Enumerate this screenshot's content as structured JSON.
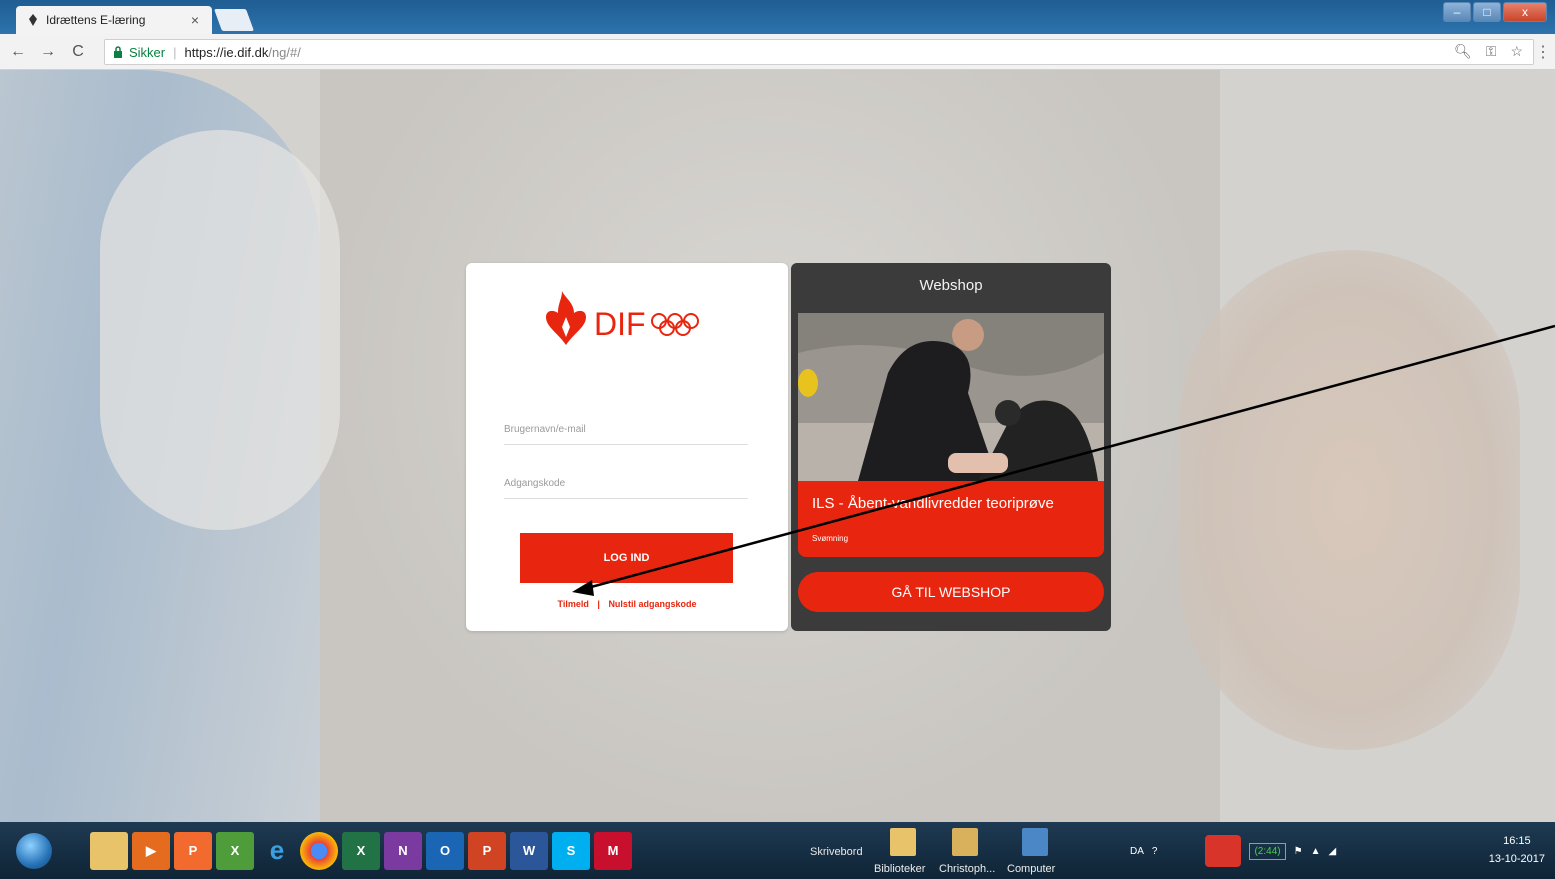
{
  "browser": {
    "tab_title": "Idrættens E-læring",
    "tab_close": "×",
    "secure_label": "Sikker",
    "url_host": "https://ie.dif.dk",
    "url_path": "/ng/#/",
    "back": "←",
    "forward": "→",
    "reload": "C",
    "zoom_icon": "zoom-icon",
    "key_icon": "key-icon",
    "star_icon": "star-icon"
  },
  "login": {
    "brand": "DIF",
    "username_placeholder": "Brugernavn/e-mail",
    "password_placeholder": "Adgangskode",
    "login_button": "LOG IND",
    "signup_link": "Tilmeld",
    "link_separator": "|",
    "reset_link": "Nulstil adgangskode"
  },
  "webshop": {
    "title": "Webshop",
    "product_name": "ILS - Åbent-vandlivredder teoriprøve",
    "product_category": "Svømning",
    "button": "GÅ TIL WEBSHOP"
  },
  "taskbar": {
    "desktop_label": "Skrivebord",
    "folders": [
      "Biblioteker",
      "Christoph...",
      "Computer"
    ],
    "language": "DA",
    "battery": "(2:44)",
    "time": "16:15",
    "date": "13-10-2017"
  },
  "colors": {
    "brand_red": "#e8260f",
    "shop_bg": "#3b3b3b"
  }
}
